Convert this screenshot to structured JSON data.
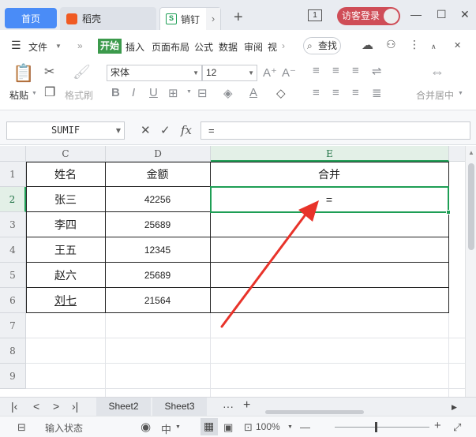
{
  "tabs": {
    "home": "首页",
    "daoke": "稻壳",
    "doc": "销钉",
    "new_tab": "+"
  },
  "titlebar": {
    "page_indicator": "1",
    "login": "访客登录",
    "minimize": "—",
    "maximize": "☐",
    "close": "✕"
  },
  "menubar": {
    "file": "文件",
    "items": [
      "开始",
      "插入",
      "页面布局",
      "公式",
      "数据",
      "审阅",
      "视"
    ],
    "search": "查找"
  },
  "ribbon": {
    "paste": "粘贴",
    "format_painter": "格式刷",
    "font_name": "宋体",
    "font_size": "12",
    "merge_center": "合并居中"
  },
  "formula_bar": {
    "name_box": "SUMIF",
    "cancel": "✕",
    "confirm": "✓",
    "fx": "fx",
    "formula": "="
  },
  "columns": [
    "C",
    "D",
    "E"
  ],
  "rows": [
    "1",
    "2",
    "3",
    "4",
    "5",
    "6",
    "7",
    "8",
    "9"
  ],
  "table": {
    "headers": [
      "姓名",
      "金额",
      "合并"
    ],
    "rows": [
      {
        "name": "张三",
        "amount": "42256",
        "merge": "="
      },
      {
        "name": "李四",
        "amount": "25689",
        "merge": ""
      },
      {
        "name": "王五",
        "amount": "12345",
        "merge": ""
      },
      {
        "name": "赵六",
        "amount": "25689",
        "merge": ""
      },
      {
        "name": "刘七",
        "amount": "21564",
        "merge": ""
      }
    ]
  },
  "sheets": [
    "Sheet2",
    "Sheet3"
  ],
  "sheet_nav": {
    "first": "K",
    "prev": "<",
    "next": ">",
    "last": "›|",
    "more": "···",
    "add": "+"
  },
  "statusbar": {
    "mode": "输入状态",
    "zoom": "100%",
    "minus": "—",
    "plus": "+"
  },
  "colors": {
    "accent_green": "#1e9e55",
    "home_tab": "#4a8cf7",
    "login": "#cf4d57",
    "arrow": "#e8332a"
  }
}
